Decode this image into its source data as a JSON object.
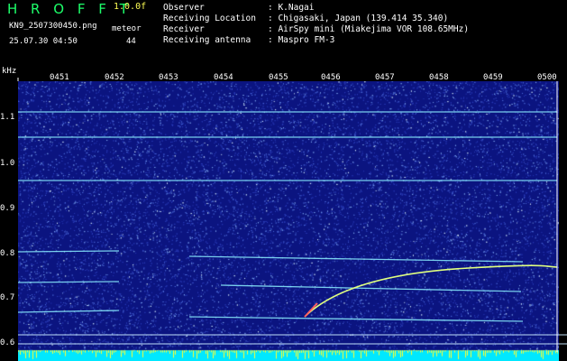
{
  "header": {
    "brand": "H R O F F T",
    "version": "1.0.0f",
    "filename": "KN9_2507300450.png",
    "meteor_label": "meteor",
    "datetime": "25.07.30 04:50",
    "meteor_count": "44"
  },
  "meta": [
    {
      "label": "Observer",
      "value": ": K.Nagai"
    },
    {
      "label": "Receiving Location",
      "value": ": Chigasaki, Japan (139.414 35.340)"
    },
    {
      "label": "Receiver",
      "value": ": AirSpy mini (Miakejima VOR 108.65MHz)"
    },
    {
      "label": "Receiving antenna",
      "value": ": Maspro FM-3"
    }
  ],
  "axis": {
    "unit": "kHz",
    "time_ticks": [
      "0451",
      "0452",
      "0453",
      "0454",
      "0455",
      "0456",
      "0457",
      "0458",
      "0459",
      "0500"
    ],
    "freq_ticks": [
      "1.1",
      "1.0",
      "0.9",
      "0.8",
      "0.7",
      "0.6"
    ]
  },
  "colors": {
    "background": "#000000",
    "brand": "#1dff6a",
    "version": "#ffff55",
    "spectrogram_bg": "#0b1480",
    "trace": "#8cf0ff",
    "meteor_head": "#ff6060",
    "bottom_band": "#00e8ff",
    "bottom_spikes": "#ffff30"
  }
}
